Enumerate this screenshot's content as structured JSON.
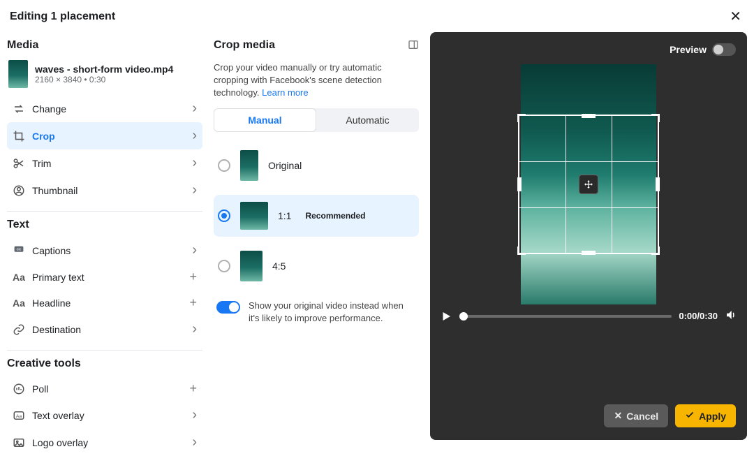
{
  "header": {
    "title": "Editing 1 placement"
  },
  "media": {
    "section_title": "Media",
    "file_name": "waves - short-form video.mp4",
    "file_sub": "2160 × 3840 • 0:30",
    "items": {
      "change": {
        "label": "Change"
      },
      "crop": {
        "label": "Crop"
      },
      "trim": {
        "label": "Trim"
      },
      "thumbnail": {
        "label": "Thumbnail"
      }
    }
  },
  "text": {
    "section_title": "Text",
    "items": {
      "captions": {
        "label": "Captions"
      },
      "primary_text": {
        "label": "Primary text"
      },
      "headline": {
        "label": "Headline"
      },
      "destination": {
        "label": "Destination"
      }
    }
  },
  "creative": {
    "section_title": "Creative tools",
    "items": {
      "poll": {
        "label": "Poll"
      },
      "text_overlay": {
        "label": "Text overlay"
      },
      "logo_overlay": {
        "label": "Logo overlay"
      }
    }
  },
  "crop": {
    "title": "Crop media",
    "desc_prefix": "Crop your video manually or try automatic cropping with Facebook's scene detection technology. ",
    "learn_more": "Learn more",
    "tabs": {
      "manual": "Manual",
      "automatic": "Automatic"
    },
    "ratios": {
      "original": {
        "label": "Original"
      },
      "one_one": {
        "label": "1:1",
        "reco": "Recommended"
      },
      "four_five": {
        "label": "4:5"
      }
    },
    "show_original_text": "Show your original video instead when it's likely to improve performance."
  },
  "preview": {
    "label": "Preview",
    "time": "0:00/0:30",
    "cancel": "Cancel",
    "apply": "Apply"
  }
}
